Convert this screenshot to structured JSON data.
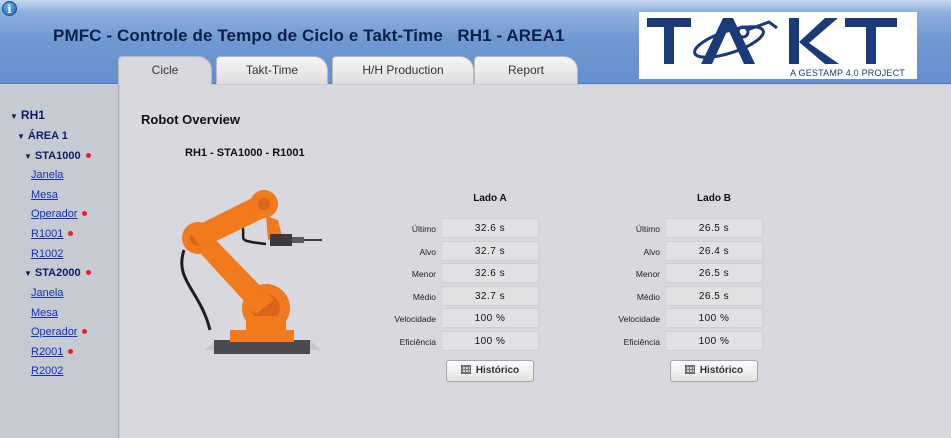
{
  "header": {
    "title": "PMFC - Controle de Tempo de Ciclo e Takt-Time   RH1 - AREA1",
    "logo_text": "TAKT",
    "logo_tagline": "A GESTAMP 4.0 PROJECT"
  },
  "tabs": [
    {
      "label": "Cicle",
      "active": true
    },
    {
      "label": "Takt-Time",
      "active": false
    },
    {
      "label": "H/H Production",
      "active": false
    },
    {
      "label": "Report",
      "active": false
    }
  ],
  "sidebar": {
    "root": "RH1",
    "area": "ÁREA 1",
    "stations": [
      {
        "label": "STA1000",
        "alert": true,
        "items": [
          {
            "label": "Janela",
            "alert": false
          },
          {
            "label": "Mesa",
            "alert": false
          },
          {
            "label": "Operador",
            "alert": true
          },
          {
            "label": "R1001",
            "alert": true
          },
          {
            "label": "R1002",
            "alert": false
          }
        ]
      },
      {
        "label": "STA2000",
        "alert": true,
        "items": [
          {
            "label": "Janela",
            "alert": false
          },
          {
            "label": "Mesa",
            "alert": false
          },
          {
            "label": "Operador",
            "alert": true
          },
          {
            "label": "R2001",
            "alert": true
          },
          {
            "label": "R2002",
            "alert": false
          }
        ]
      }
    ]
  },
  "main": {
    "section_title": "Robot Overview",
    "robot_path": "RH1 - STA1000 - R1001",
    "sides": [
      {
        "title": "Lado A",
        "rows": [
          {
            "label": "Último",
            "value": "32.6 s"
          },
          {
            "label": "Alvo",
            "value": "32.7 s"
          },
          {
            "label": "Menor",
            "value": "32.6 s"
          },
          {
            "label": "Médio",
            "value": "32.7 s"
          },
          {
            "label": "Velocidade",
            "value": "100 %"
          },
          {
            "label": "Eficiência",
            "value": "100 %"
          }
        ],
        "button": "Histórico"
      },
      {
        "title": "Lado B",
        "rows": [
          {
            "label": "Último",
            "value": "26.5 s"
          },
          {
            "label": "Alvo",
            "value": "26.4 s"
          },
          {
            "label": "Menor",
            "value": "26.5 s"
          },
          {
            "label": "Médio",
            "value": "26.5 s"
          },
          {
            "label": "Velocidade",
            "value": "100 %"
          },
          {
            "label": "Eficiência",
            "value": "100 %"
          }
        ],
        "button": "Histórico"
      }
    ]
  },
  "colors": {
    "header_blue": "#6f97d2",
    "title_navy": "#0b1f48",
    "robot_orange": "#f07a1c",
    "alert_red": "#e8202a",
    "link_blue": "#1532b8"
  },
  "icons": {
    "info": "info-icon",
    "tree_expand": "triangle-down-icon",
    "history": "table-grid-icon"
  }
}
